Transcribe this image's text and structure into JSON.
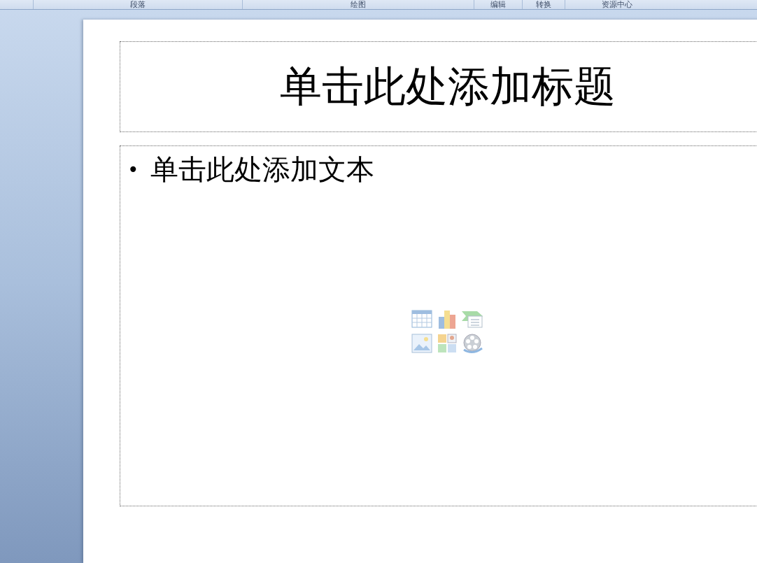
{
  "ribbon_groups": [
    {
      "label": "段落"
    },
    {
      "label": "绘图"
    },
    {
      "label": "编辑"
    },
    {
      "label": "转换"
    },
    {
      "label": "资源中心"
    }
  ],
  "slide": {
    "title_placeholder": "单击此处添加标题",
    "body_placeholder": {
      "bullet": "•",
      "text": "单击此处添加文本"
    },
    "insert_icons": [
      {
        "kind": "table"
      },
      {
        "kind": "chart"
      },
      {
        "kind": "smartart"
      },
      {
        "kind": "picture"
      },
      {
        "kind": "clipart"
      },
      {
        "kind": "media"
      }
    ]
  }
}
